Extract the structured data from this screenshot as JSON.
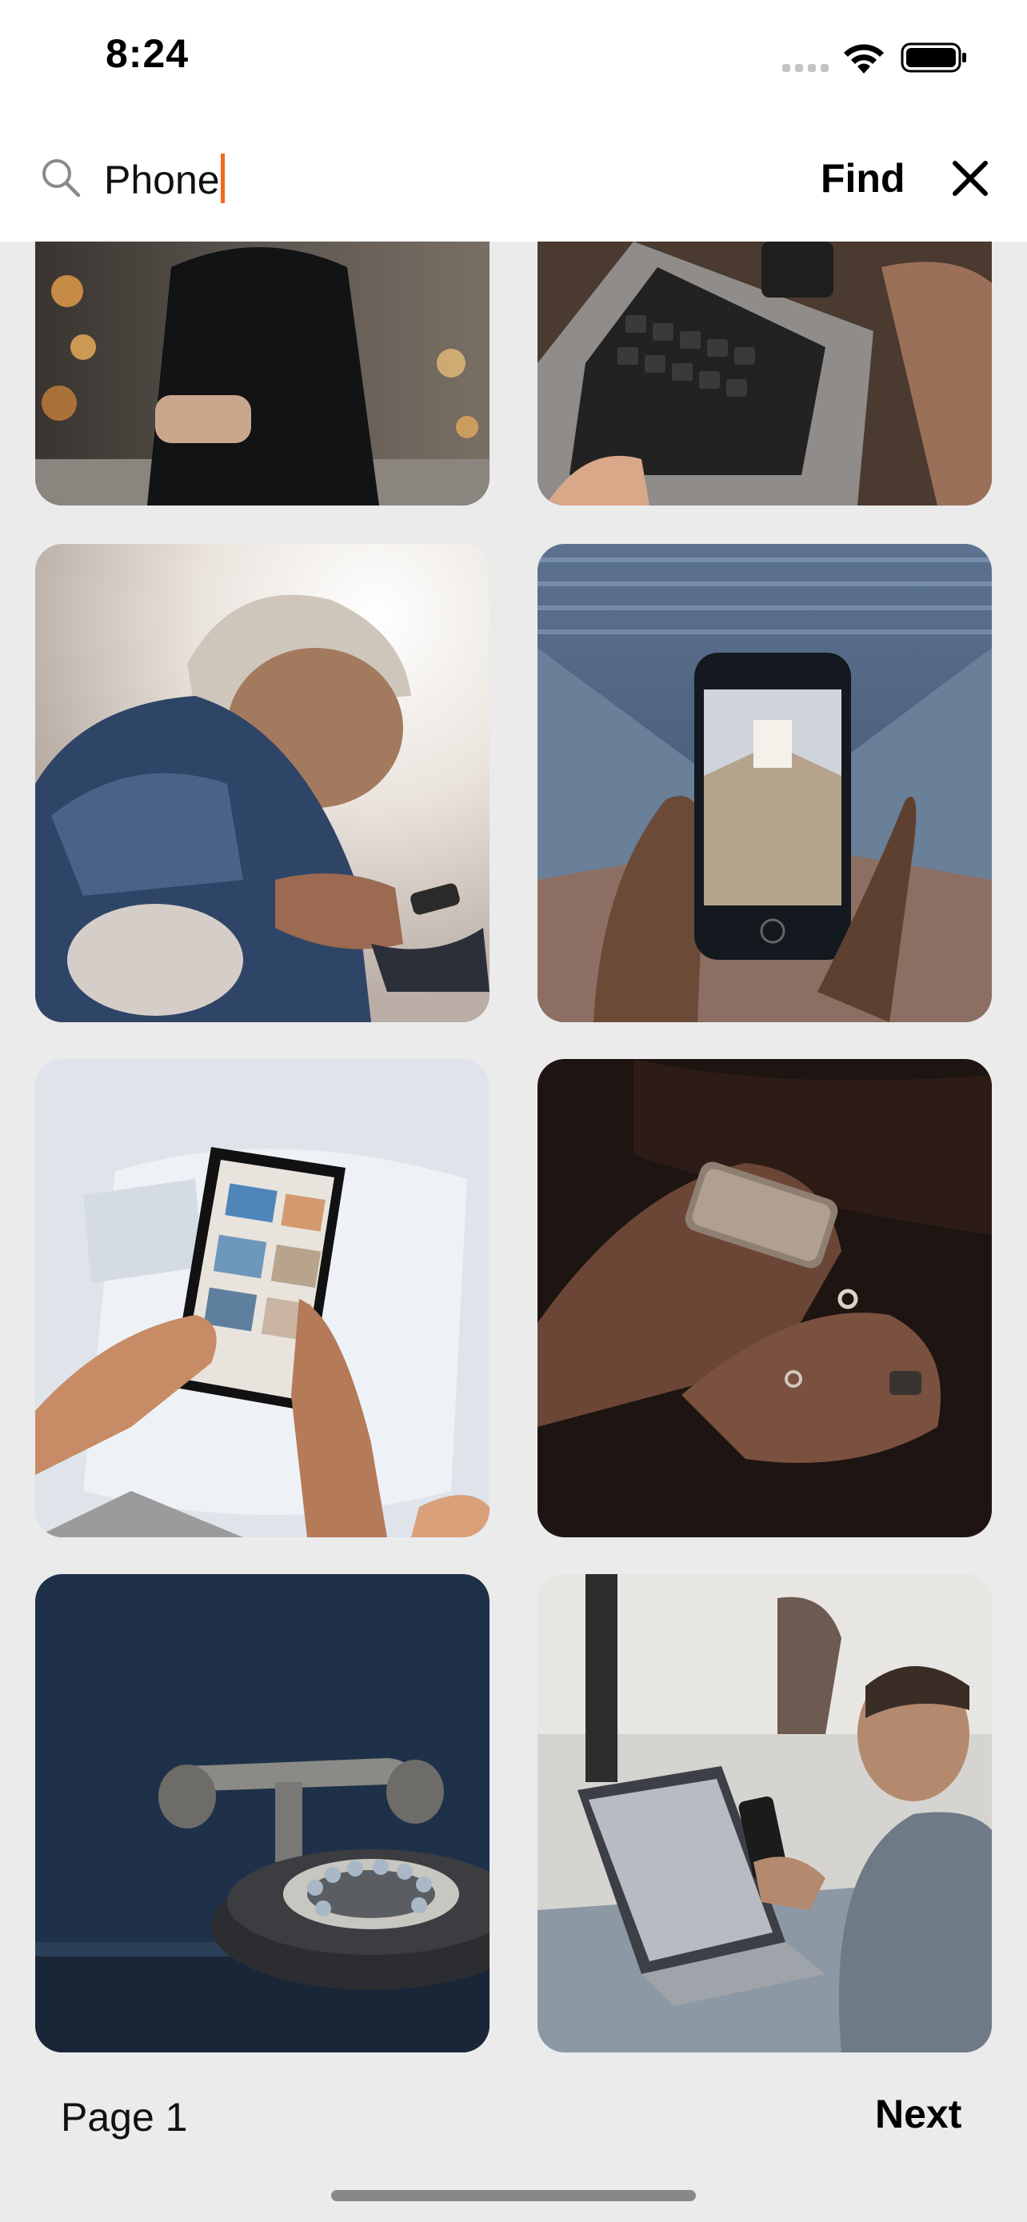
{
  "status_bar": {
    "time": "8:24",
    "icons": [
      "cellular-signal-icon",
      "wifi-icon",
      "battery-icon"
    ]
  },
  "search": {
    "icon": "search-icon",
    "value": "Phone",
    "find_label": "Find",
    "close_icon": "close-icon"
  },
  "results": {
    "items": [
      {
        "subject": "person-holding-phone-street-partial"
      },
      {
        "subject": "laptop-keyboard-and-phone-partial"
      },
      {
        "subject": "woman-in-beanie-using-phone"
      },
      {
        "subject": "hand-holding-iphone-corridor"
      },
      {
        "subject": "hands-holding-smartphone-photos"
      },
      {
        "subject": "hands-with-rings-holding-phone-dark"
      },
      {
        "subject": "vintage-rotary-telephone"
      },
      {
        "subject": "man-with-laptop-and-phone"
      }
    ]
  },
  "footer": {
    "page_label": "Page 1",
    "next_label": "Next"
  },
  "colors": {
    "accent": "#f26a1b",
    "background": "#ebebeb",
    "surface": "#ffffff"
  }
}
